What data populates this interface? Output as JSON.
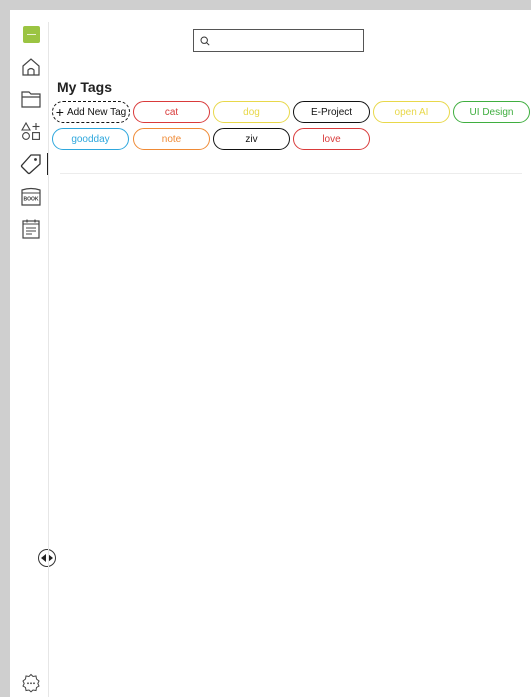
{
  "sidebar": {
    "items": [
      {
        "name": "home",
        "icon": "home-icon"
      },
      {
        "name": "folders",
        "icon": "folder-icon"
      },
      {
        "name": "shapes",
        "icon": "shapes-icon"
      },
      {
        "name": "tags",
        "icon": "tag-icon",
        "active": true
      },
      {
        "name": "book",
        "icon": "book-icon",
        "label": "BOOK"
      },
      {
        "name": "calendar",
        "icon": "calendar-icon"
      }
    ],
    "collapse_icon": "collapse-toggle-icon",
    "settings_icon": "settings-icon",
    "accent_color": "#9bc442"
  },
  "search": {
    "placeholder": "",
    "value": ""
  },
  "main": {
    "title": "My Tags",
    "add_tag_label": "Add New Tag",
    "tags": [
      {
        "label": "cat",
        "color": "#d93a3a"
      },
      {
        "label": "dog",
        "color": "#e8d84a"
      },
      {
        "label": "E-Project",
        "color": "#111111"
      },
      {
        "label": "open AI",
        "color": "#e8d84a"
      },
      {
        "label": "UI Design",
        "color": "#3fae3f"
      },
      {
        "label": "goodday",
        "color": "#2ea7dd"
      },
      {
        "label": "note",
        "color": "#ef8a35"
      },
      {
        "label": "ziv",
        "color": "#111111"
      },
      {
        "label": "love",
        "color": "#d93a3a"
      }
    ]
  }
}
